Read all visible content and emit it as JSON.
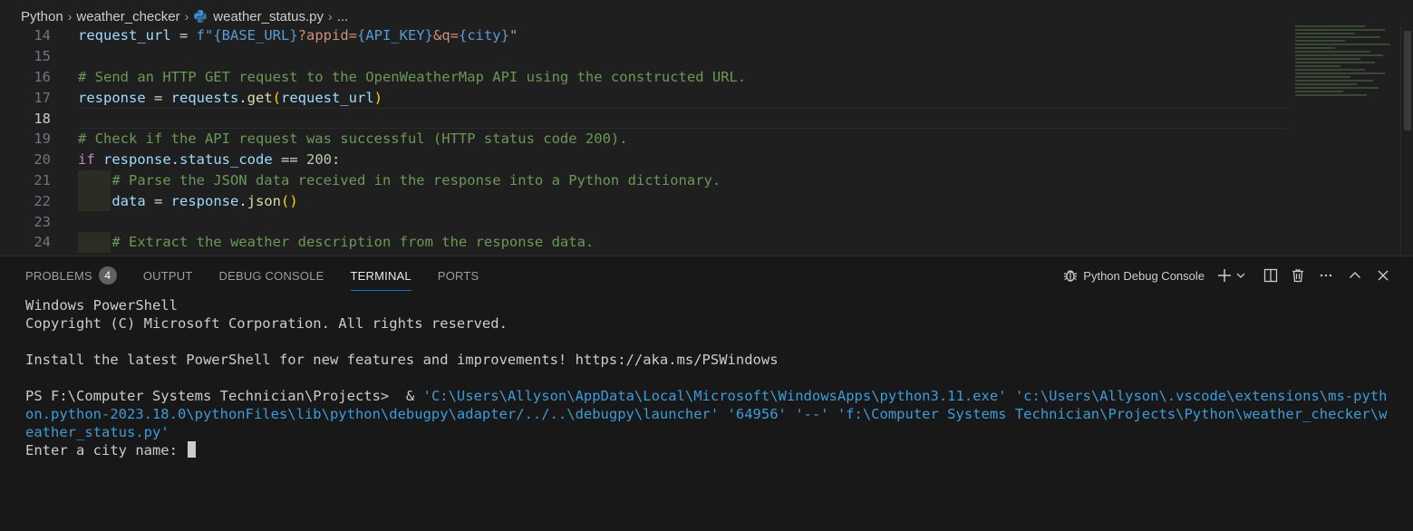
{
  "breadcrumb": {
    "items": [
      "Python",
      "weather_checker",
      "weather_status.py",
      "..."
    ],
    "file_icon": "python-file-icon"
  },
  "editor": {
    "current_line": 18,
    "lines": [
      {
        "n": 14,
        "segments": [
          {
            "t": "request_url",
            "c": "var"
          },
          {
            "t": " = ",
            "c": "op"
          },
          {
            "t": "f\"",
            "c": "brace"
          },
          {
            "t": "{BASE_URL}",
            "c": "brace"
          },
          {
            "t": "?appid=",
            "c": "str"
          },
          {
            "t": "{API_KEY}",
            "c": "brace"
          },
          {
            "t": "&q=",
            "c": "str"
          },
          {
            "t": "{city}",
            "c": "brace"
          },
          {
            "t": "\"",
            "c": "str"
          }
        ]
      },
      {
        "n": 15,
        "segments": []
      },
      {
        "n": 16,
        "segments": [
          {
            "t": "# Send an HTTP GET request to the OpenWeatherMap API using the constructed URL.",
            "c": "com"
          }
        ]
      },
      {
        "n": 17,
        "segments": [
          {
            "t": "response",
            "c": "var"
          },
          {
            "t": " = ",
            "c": "op"
          },
          {
            "t": "requests",
            "c": "var"
          },
          {
            "t": ".",
            "c": "op"
          },
          {
            "t": "get",
            "c": "fn"
          },
          {
            "t": "(",
            "c": "paren"
          },
          {
            "t": "request_url",
            "c": "var"
          },
          {
            "t": ")",
            "c": "paren"
          }
        ]
      },
      {
        "n": 18,
        "segments": []
      },
      {
        "n": 19,
        "segments": [
          {
            "t": "# Check if the API request was successful (HTTP status code 200).",
            "c": "com"
          }
        ]
      },
      {
        "n": 20,
        "segments": [
          {
            "t": "if",
            "c": "kw"
          },
          {
            "t": " ",
            "c": "op"
          },
          {
            "t": "response",
            "c": "var"
          },
          {
            "t": ".",
            "c": "op"
          },
          {
            "t": "status_code",
            "c": "var"
          },
          {
            "t": " == ",
            "c": "op"
          },
          {
            "t": "200",
            "c": "num"
          },
          {
            "t": ":",
            "c": "op"
          }
        ]
      },
      {
        "n": 21,
        "indent": true,
        "segments": [
          {
            "t": "    # Parse the JSON data received in the response into a Python dictionary.",
            "c": "com"
          }
        ]
      },
      {
        "n": 22,
        "indent": true,
        "segments": [
          {
            "t": "    ",
            "c": "op"
          },
          {
            "t": "data",
            "c": "var"
          },
          {
            "t": " = ",
            "c": "op"
          },
          {
            "t": "response",
            "c": "var"
          },
          {
            "t": ".",
            "c": "op"
          },
          {
            "t": "json",
            "c": "fn"
          },
          {
            "t": "(",
            "c": "paren"
          },
          {
            "t": ")",
            "c": "paren"
          }
        ]
      },
      {
        "n": 23,
        "segments": []
      },
      {
        "n": 24,
        "indent": true,
        "segments": [
          {
            "t": "    # Extract the weather description from the response data.",
            "c": "com"
          }
        ]
      }
    ]
  },
  "panel": {
    "tabs": [
      {
        "label": "PROBLEMS",
        "badge": "4"
      },
      {
        "label": "OUTPUT"
      },
      {
        "label": "DEBUG CONSOLE"
      },
      {
        "label": "TERMINAL",
        "active": true
      },
      {
        "label": "PORTS"
      }
    ],
    "terminal_profile": "Python Debug Console",
    "actions": [
      "debug-icon",
      "add-icon",
      "chevron-down-icon",
      "split-icon",
      "trash-icon",
      "more-icon",
      "maximize-icon",
      "close-icon"
    ]
  },
  "terminal": {
    "line1": "Windows PowerShell",
    "line2": "Copyright (C) Microsoft Corporation. All rights reserved.",
    "line3": "",
    "line4": "Install the latest PowerShell for new features and improvements! https://aka.ms/PSWindows",
    "line5": "",
    "prompt": "PS F:\\Computer Systems Technician\\Projects>  & ",
    "command": "'C:\\Users\\Allyson\\AppData\\Local\\Microsoft\\WindowsApps\\python3.11.exe' 'c:\\Users\\Allyson\\.vscode\\extensions\\ms-python.python-2023.18.0\\pythonFiles\\lib\\python\\debugpy\\adapter/../..\\debugpy\\launcher' '64956' '--' 'f:\\Computer Systems Technician\\Projects\\Python\\weather_checker\\weather_status.py'",
    "input_prompt": "Enter a city name: "
  }
}
